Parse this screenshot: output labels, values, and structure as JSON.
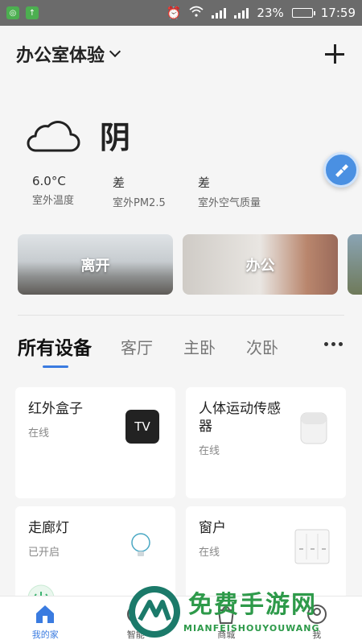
{
  "status_bar": {
    "battery": "23%",
    "time": "17:59"
  },
  "header": {
    "home_name": "办公室体验"
  },
  "weather": {
    "condition": "阴",
    "stats": [
      {
        "value": "6.0°C",
        "label": "室外温度"
      },
      {
        "value": "差",
        "label": "室外PM2.5"
      },
      {
        "value": "差",
        "label": "室外空气质量"
      }
    ]
  },
  "scenes": [
    {
      "name": "离开"
    },
    {
      "name": "办公"
    }
  ],
  "device_tabs": [
    "所有设备",
    "客厅",
    "主卧",
    "次卧"
  ],
  "devices": [
    {
      "name": "红外盒子",
      "status": "在线",
      "icon": "tv-box-icon",
      "icon_text": "TV"
    },
    {
      "name": "人体运动传感器",
      "status": "在线",
      "icon": "motion-sensor-icon"
    },
    {
      "name": "走廊灯",
      "status": "已开启",
      "icon": "bulb-icon"
    },
    {
      "name": "窗户",
      "status": "在线",
      "icon": "wall-switch-icon"
    }
  ],
  "bottom_nav": [
    {
      "label": "我的家",
      "icon": "home-icon",
      "active": true
    },
    {
      "label": "智能",
      "icon": "smart-icon"
    },
    {
      "label": "商城",
      "icon": "shop-icon"
    },
    {
      "label": "我",
      "icon": "profile-icon"
    }
  ],
  "watermark": {
    "title": "免费手游网",
    "subtitle": "MIANFEISHOUYOUWANG"
  },
  "colors": {
    "accent": "#3a7be0",
    "status_bar": "#6b6b6b",
    "background": "#f5f5f5",
    "watermark": "#2e9a4a"
  }
}
